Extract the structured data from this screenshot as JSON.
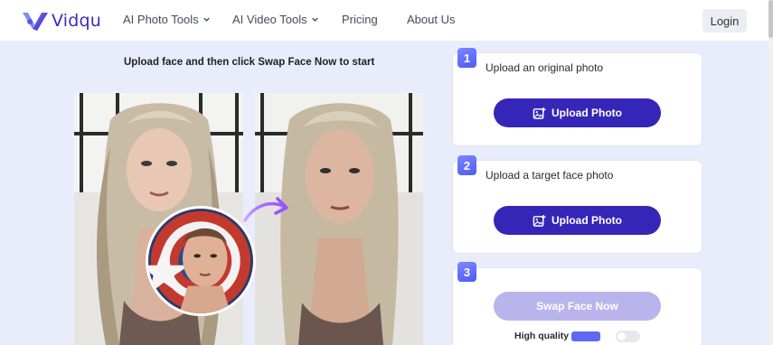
{
  "brand": {
    "name": "Vidqu",
    "colors": {
      "primary": "#3526b8",
      "accent": "#5e68f5",
      "disabled": "#b9b4ec"
    }
  },
  "nav": {
    "items": [
      {
        "label": "AI Photo Tools",
        "has_dropdown": true
      },
      {
        "label": "AI Video Tools",
        "has_dropdown": true
      },
      {
        "label": "Pricing",
        "has_dropdown": false
      },
      {
        "label": "About Us",
        "has_dropdown": false
      }
    ],
    "login_label": "Login"
  },
  "demo": {
    "instruction": "Upload face and then click Swap Face Now to start",
    "icons": [
      "source-photo",
      "result-photo",
      "face-thumbnail",
      "curved-arrow-icon"
    ]
  },
  "steps": [
    {
      "number": "1",
      "title": "Upload an original photo",
      "button_label": "Upload Photo",
      "icon": "image-upload-icon"
    },
    {
      "number": "2",
      "title": "Upload a target face photo",
      "button_label": "Upload Photo",
      "icon": "image-upload-icon"
    },
    {
      "number": "3",
      "button_label": "Swap Face Now",
      "button_enabled": false
    }
  ],
  "quality": {
    "label": "High quality",
    "enabled": false
  }
}
